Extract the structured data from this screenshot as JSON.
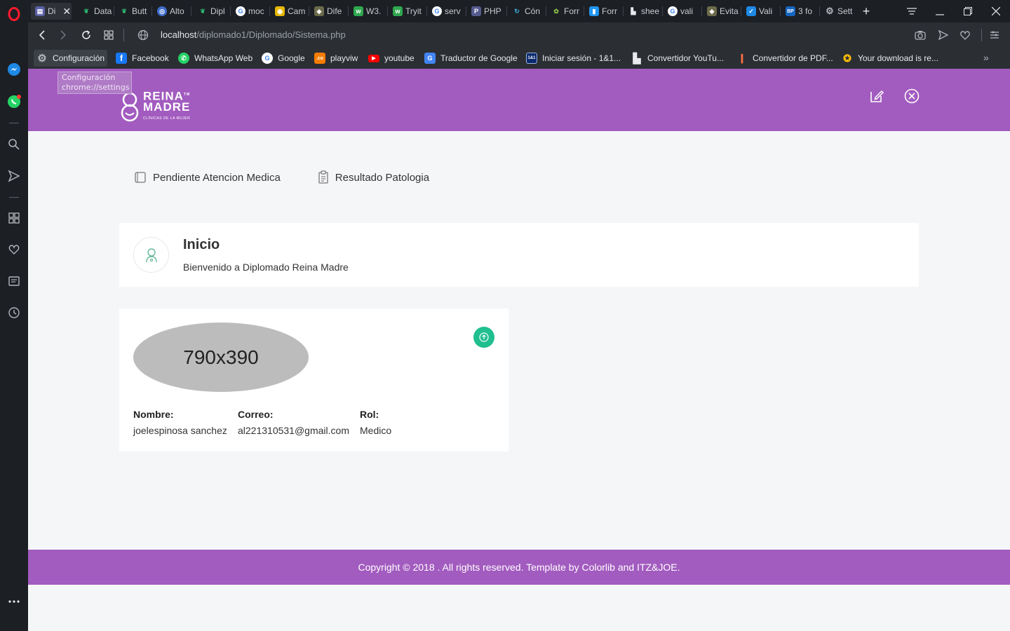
{
  "browser": {
    "tabs": [
      {
        "label": "Di",
        "active": true
      },
      {
        "label": "Data"
      },
      {
        "label": "Butt"
      },
      {
        "label": "Alto"
      },
      {
        "label": "Dipl"
      },
      {
        "label": "moc"
      },
      {
        "label": "Cam"
      },
      {
        "label": "Dife"
      },
      {
        "label": "W3."
      },
      {
        "label": "Tryit"
      },
      {
        "label": "serv"
      },
      {
        "label": "PHP"
      },
      {
        "label": "Cón"
      },
      {
        "label": "Forr"
      },
      {
        "label": "Forr"
      },
      {
        "label": "shee"
      },
      {
        "label": "vali"
      },
      {
        "label": "Evita"
      },
      {
        "label": "Vali"
      },
      {
        "label": "3 fo"
      },
      {
        "label": "Sett"
      }
    ],
    "url_host": "localhost",
    "url_path": "/diplomado1/Diplomado/Sistema.php",
    "bookmarks": [
      {
        "label": "Configuración"
      },
      {
        "label": "Facebook"
      },
      {
        "label": "WhatsApp Web"
      },
      {
        "label": "Google"
      },
      {
        "label": "playviw"
      },
      {
        "label": "youtube"
      },
      {
        "label": "Traductor de Google"
      },
      {
        "label": "Iniciar sesión - 1&1..."
      },
      {
        "label": "Convertidor YouTu..."
      },
      {
        "label": "Convertidor de PDF..."
      },
      {
        "label": "Your download is re..."
      }
    ],
    "tooltip_line1": "Configuración",
    "tooltip_line2": "chrome://settings"
  },
  "header": {
    "logo_line1": "REINA",
    "logo_line2": "MADRE",
    "logo_line3": "CLÍNICAS DE LA MUJER",
    "logo_tm": "TM"
  },
  "nav": {
    "items": [
      {
        "label": "Pendiente Atencion Medica"
      },
      {
        "label": "Resultado Patologia"
      }
    ]
  },
  "inicio": {
    "title": "Inicio",
    "subtitle": "Bienvenido a Diplomado Reina Madre"
  },
  "profile": {
    "photo_placeholder": "790x390",
    "nombre_label": "Nombre:",
    "nombre_value": "joelespinosa sanchez",
    "correo_label": "Correo:",
    "correo_value": "al221310531@gmail.com",
    "rol_label": "Rol:",
    "rol_value": "Medico"
  },
  "footer": {
    "text": "Copyright © 2018 . All rights reserved. Template by Colorlib and ITZ&JOE."
  },
  "colors": {
    "brand_purple": "#a25bbf",
    "upload_green": "#1fbf8f"
  }
}
